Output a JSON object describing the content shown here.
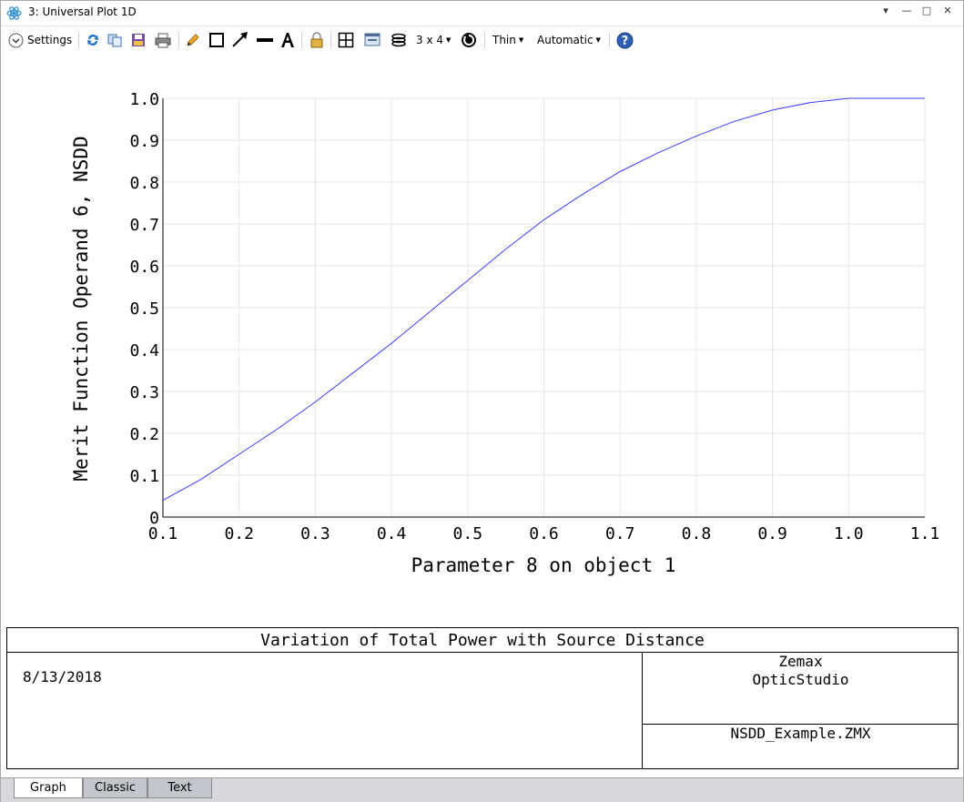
{
  "window": {
    "title": "3: Universal Plot 1D",
    "controls": [
      "▾",
      "—",
      "□",
      "✕"
    ]
  },
  "toolbar": {
    "settings_label": "Settings",
    "grid_label": "3 x 4",
    "line_label": "Thin",
    "scale_label": "Automatic",
    "icons": [
      "refresh-icon",
      "copy-icon",
      "save-icon",
      "print-icon",
      "pencil-icon",
      "rectangle-icon",
      "arrow-icon",
      "line-icon",
      "text-icon",
      "lock-icon",
      "grid-icon",
      "window-icon",
      "layers-icon",
      "clock-icon",
      "help-icon"
    ]
  },
  "chart_data": {
    "type": "line",
    "xlabel": "Parameter 8 on object 1",
    "ylabel": "Merit Function Operand 6, NSDD",
    "xlim": [
      0.1,
      1.1
    ],
    "ylim": [
      0,
      1.0
    ],
    "x_ticks": [
      "0.1",
      "0.2",
      "0.3",
      "0.4",
      "0.5",
      "0.6",
      "0.7",
      "0.8",
      "0.9",
      "1.0",
      "1.1"
    ],
    "y_ticks": [
      "0",
      "0.1",
      "0.2",
      "0.3",
      "0.4",
      "0.5",
      "0.6",
      "0.7",
      "0.8",
      "0.9",
      "1.0"
    ],
    "grid": true,
    "line_color": "#3b3bff",
    "series": [
      {
        "x": [
          0.1,
          0.15,
          0.2,
          0.25,
          0.3,
          0.35,
          0.4,
          0.45,
          0.5,
          0.55,
          0.6,
          0.65,
          0.7,
          0.75,
          0.8,
          0.85,
          0.9,
          0.95,
          1.0,
          1.05,
          1.1
        ],
        "y": [
          0.04,
          0.09,
          0.15,
          0.21,
          0.275,
          0.345,
          0.415,
          0.49,
          0.565,
          0.64,
          0.71,
          0.77,
          0.825,
          0.87,
          0.91,
          0.945,
          0.972,
          0.99,
          1.0,
          1.0,
          1.0
        ]
      }
    ]
  },
  "title_block": {
    "title": "Variation of Total Power with Source Distance",
    "date": "8/13/2018",
    "company_line1": "Zemax",
    "company_line2": "OpticStudio",
    "file": "NSDD_Example.ZMX"
  },
  "tabs": [
    {
      "label": "Graph",
      "active": true
    },
    {
      "label": "Classic",
      "active": false
    },
    {
      "label": "Text",
      "active": false
    }
  ]
}
